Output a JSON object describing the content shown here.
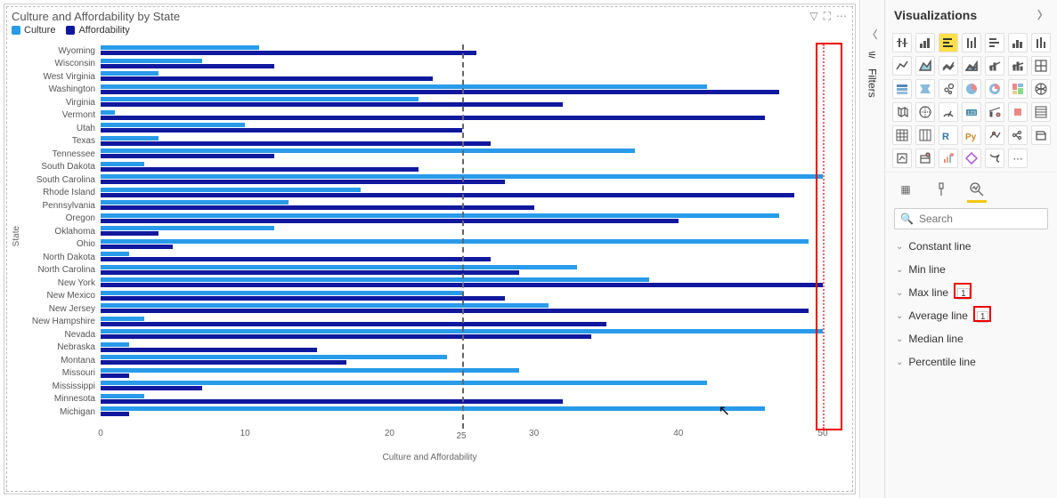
{
  "chart": {
    "title": "Culture and Affordability by State",
    "legend": {
      "culture": "Culture",
      "afford": "Affordability"
    },
    "y_label": "State",
    "x_label": "Culture and Affordability",
    "ticks": [
      0,
      10,
      20,
      30,
      40,
      50
    ],
    "avg_label": "25",
    "colors": {
      "culture": "#289bea",
      "afford": "#10189e"
    }
  },
  "chart_data": {
    "type": "bar",
    "orientation": "horizontal",
    "x_field": "State",
    "series": [
      {
        "name": "Culture",
        "color": "#289bea"
      },
      {
        "name": "Affordability",
        "color": "#10189e"
      }
    ],
    "xlim": [
      0,
      50
    ],
    "reference_lines": {
      "average": 25,
      "max": 50
    },
    "data": [
      {
        "state": "Wyoming",
        "culture": 11,
        "afford": 26
      },
      {
        "state": "Wisconsin",
        "culture": 7,
        "afford": 12
      },
      {
        "state": "West Virginia",
        "culture": 4,
        "afford": 23
      },
      {
        "state": "Washington",
        "culture": 42,
        "afford": 47
      },
      {
        "state": "Virginia",
        "culture": 22,
        "afford": 32
      },
      {
        "state": "Vermont",
        "culture": 1,
        "afford": 46
      },
      {
        "state": "Utah",
        "culture": 10,
        "afford": 25
      },
      {
        "state": "Texas",
        "culture": 4,
        "afford": 27
      },
      {
        "state": "Tennessee",
        "culture": 37,
        "afford": 12
      },
      {
        "state": "South Dakota",
        "culture": 3,
        "afford": 22
      },
      {
        "state": "South Carolina",
        "culture": 50,
        "afford": 28
      },
      {
        "state": "Rhode Island",
        "culture": 18,
        "afford": 48
      },
      {
        "state": "Pennsylvania",
        "culture": 13,
        "afford": 30
      },
      {
        "state": "Oregon",
        "culture": 47,
        "afford": 40
      },
      {
        "state": "Oklahoma",
        "culture": 12,
        "afford": 4
      },
      {
        "state": "Ohio",
        "culture": 49,
        "afford": 5
      },
      {
        "state": "North Dakota",
        "culture": 2,
        "afford": 27
      },
      {
        "state": "North Carolina",
        "culture": 33,
        "afford": 29
      },
      {
        "state": "New York",
        "culture": 38,
        "afford": 50
      },
      {
        "state": "New Mexico",
        "culture": 25,
        "afford": 28
      },
      {
        "state": "New Jersey",
        "culture": 31,
        "afford": 49
      },
      {
        "state": "New Hampshire",
        "culture": 3,
        "afford": 35
      },
      {
        "state": "Nevada",
        "culture": 50,
        "afford": 34
      },
      {
        "state": "Nebraska",
        "culture": 2,
        "afford": 15
      },
      {
        "state": "Montana",
        "culture": 24,
        "afford": 17
      },
      {
        "state": "Missouri",
        "culture": 29,
        "afford": 2
      },
      {
        "state": "Mississippi",
        "culture": 42,
        "afford": 7
      },
      {
        "state": "Minnesota",
        "culture": 3,
        "afford": 32
      },
      {
        "state": "Michigan",
        "culture": 46,
        "afford": 2
      }
    ]
  },
  "filters": {
    "label": "Filters"
  },
  "viz": {
    "title": "Visualizations",
    "search_placeholder": "Search",
    "lines": {
      "constant": "Constant line",
      "min": "Min line",
      "max": "Max line",
      "average": "Average line",
      "median": "Median line",
      "percentile": "Percentile line"
    },
    "badges": {
      "max": "1",
      "average": "1"
    }
  }
}
